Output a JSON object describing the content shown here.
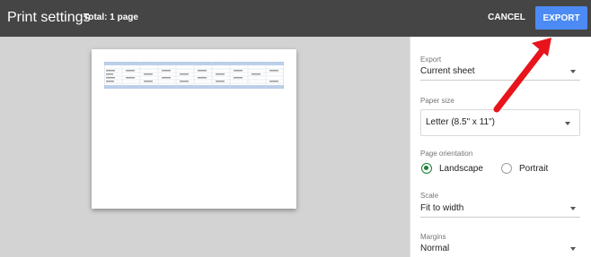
{
  "header": {
    "title": "Print settings",
    "total": "Total: 1 page",
    "cancel_label": "CANCEL",
    "export_label": "EXPORT"
  },
  "settings": {
    "export": {
      "label": "Export",
      "value": "Current sheet"
    },
    "paper_size": {
      "label": "Paper size",
      "value": "Letter (8.5\" x 11\")"
    },
    "orientation": {
      "label": "Page orientation",
      "options": [
        "Landscape",
        "Portrait"
      ],
      "selected": "Landscape"
    },
    "scale": {
      "label": "Scale",
      "value": "Fit to width"
    },
    "margins": {
      "label": "Margins",
      "value": "Normal"
    }
  },
  "colors": {
    "topbar": "#454545",
    "export_button": "#4c8bf5",
    "preview_background": "#d3d3d3",
    "radio_selected": "#188038",
    "annotation_arrow": "#e8141b"
  }
}
